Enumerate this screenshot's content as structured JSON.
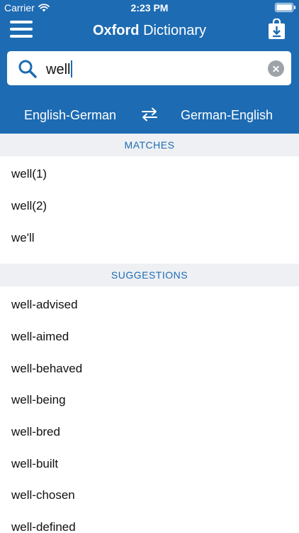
{
  "status_bar": {
    "carrier": "Carrier",
    "time": "2:23 PM"
  },
  "header": {
    "title_bold": "Oxford",
    "title_rest": " Dictionary"
  },
  "search": {
    "value": "well"
  },
  "languages": {
    "left": "English-German",
    "right": "German-English"
  },
  "matches": {
    "title": "MATCHES",
    "items": [
      "well(1)",
      "well(2)",
      "we'll"
    ]
  },
  "suggestions": {
    "title": "SUGGESTIONS",
    "items": [
      "well-advised",
      "well-aimed",
      "well-behaved",
      "well-being",
      "well-bred",
      "well-built",
      "well-chosen",
      "well-defined"
    ]
  },
  "colors": {
    "brand_blue": "#1d6bb3",
    "section_bg": "#eef0f3"
  },
  "icons": [
    "menu-icon",
    "download-bag-icon",
    "search-icon",
    "clear-icon",
    "swap-icon",
    "wifi-icon",
    "battery-icon"
  ]
}
